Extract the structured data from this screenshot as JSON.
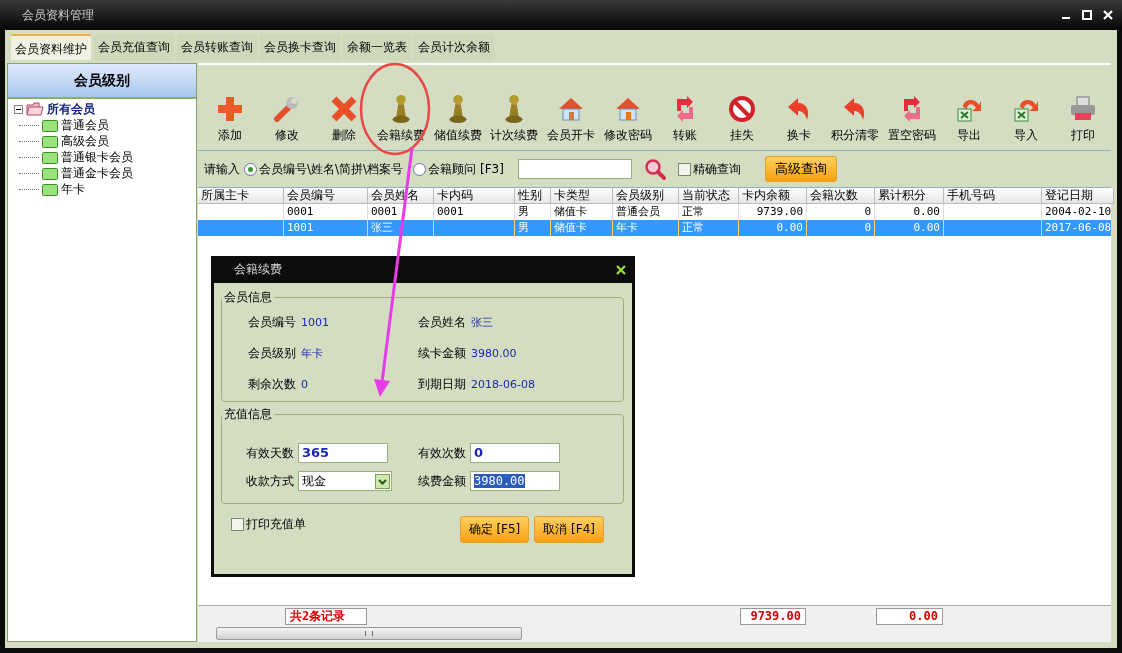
{
  "window": {
    "title": "会员资料管理"
  },
  "tabs": [
    {
      "label": "会员资料维护",
      "selected": true
    },
    {
      "label": "会员充值查询",
      "selected": false
    },
    {
      "label": "会员转账查询",
      "selected": false
    },
    {
      "label": "会员换卡查询",
      "selected": false
    },
    {
      "label": "余额一览表",
      "selected": false
    },
    {
      "label": "会员计次余额",
      "selected": false
    }
  ],
  "sidebar": {
    "title": "会员级别",
    "tree": [
      {
        "label": "所有会员",
        "expanded": true,
        "children": [
          {
            "label": "普通会员"
          },
          {
            "label": "高级会员"
          },
          {
            "label": "普通银卡会员"
          },
          {
            "label": "普通金卡会员"
          },
          {
            "label": "年卡"
          }
        ]
      }
    ]
  },
  "toolbar": [
    {
      "label": "添加",
      "kind": "plus"
    },
    {
      "label": "修改",
      "kind": "wrench"
    },
    {
      "label": "删除",
      "kind": "cross"
    },
    {
      "label": "会籍续费",
      "kind": "pawn"
    },
    {
      "label": "储值续费",
      "kind": "pawn"
    },
    {
      "label": "计次续费",
      "kind": "pawn"
    },
    {
      "label": "会员开卡",
      "kind": "house"
    },
    {
      "label": "修改密码",
      "kind": "house"
    },
    {
      "label": "转账",
      "kind": "cycle"
    },
    {
      "label": "挂失",
      "kind": "ban"
    },
    {
      "label": "换卡",
      "kind": "curve"
    },
    {
      "label": "积分清零",
      "kind": "curve"
    },
    {
      "label": "置空密码",
      "kind": "cycle"
    },
    {
      "label": "导出",
      "kind": "sheet"
    },
    {
      "label": "导入",
      "kind": "sheet"
    },
    {
      "label": "打印",
      "kind": "printer"
    }
  ],
  "search": {
    "prompt": "请输入",
    "options": [
      {
        "label": "会员编号\\姓名\\简拼\\档案号",
        "selected": true
      },
      {
        "label": "会籍顾问 [F3]",
        "selected": false
      }
    ],
    "exact": {
      "label": "精确查询",
      "checked": false
    },
    "advanced_button": "高级查询"
  },
  "table": {
    "columns": [
      {
        "label": "所属主卡"
      },
      {
        "label": "会员编号"
      },
      {
        "label": "会员姓名"
      },
      {
        "label": "卡内码"
      },
      {
        "label": "性别"
      },
      {
        "label": "卡类型"
      },
      {
        "label": "会员级别"
      },
      {
        "label": "当前状态"
      },
      {
        "label": "卡内余额"
      },
      {
        "label": "会籍次数"
      },
      {
        "label": "累计积分"
      },
      {
        "label": "手机号码"
      },
      {
        "label": "登记日期"
      }
    ],
    "rows": [
      {
        "selected": false,
        "cells": {
          "1": "0001",
          "2": "0001",
          "3": "0001",
          "4": "男",
          "5": "储值卡",
          "6": "普通会员",
          "7": "正常",
          "8": "9739.00",
          "9": "0",
          "10": "0.00",
          "12": "2004-02-10"
        }
      },
      {
        "selected": true,
        "cells": {
          "1": "1001",
          "2": "张三",
          "4": "男",
          "5": "储值卡",
          "6": "年卡",
          "7": "正常",
          "8": "0.00",
          "9": "0",
          "10": "0.00",
          "12": "2017-06-08"
        }
      }
    ],
    "footer": {
      "1": "共2条记录",
      "8": "9739.00",
      "10": "0.00"
    }
  },
  "dialog": {
    "title": "会籍续费",
    "member_info": {
      "title": "会员信息",
      "items": [
        {
          "label": "会员编号",
          "value": "1001"
        },
        {
          "label": "会员姓名",
          "value": "张三"
        },
        {
          "label": "会员级别",
          "value": "年卡"
        },
        {
          "label": "续卡金额",
          "value": "3980.00"
        },
        {
          "label": "剩余次数",
          "value": "0"
        },
        {
          "label": "到期日期",
          "value": "2018-06-08"
        }
      ]
    },
    "recharge_info": {
      "title": "充值信息",
      "valid_days": {
        "label": "有效天数",
        "value": "365"
      },
      "valid_times": {
        "label": "有效次数",
        "value": "0"
      },
      "payment": {
        "label": "收款方式",
        "value": "现金"
      },
      "amount": {
        "label": "续费金额",
        "value": "3980.00"
      }
    },
    "print_receipt": {
      "label": "打印充值单",
      "checked": false
    },
    "buttons": [
      "确定 [F5]",
      "取消 [F4]"
    ]
  }
}
